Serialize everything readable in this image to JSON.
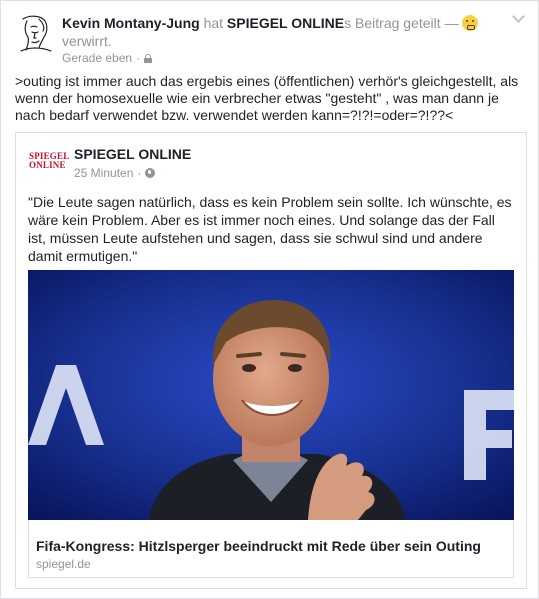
{
  "post": {
    "author": "Kevin Montany-Jung",
    "shared_word": "hat",
    "page_name": "SPIEGEL ONLINE",
    "shared_suffix": "s Beitrag geteilt —",
    "feeling": "verwirrt.",
    "time": "Gerade eben",
    "dot": "·",
    "text": ">outing ist immer auch das ergebis eines (öffentlichen) verhör's gleichgestellt, als wenn der homosexuelle wie ein  verbrecher etwas \"gesteht\" , was man dann je nach bedarf verwendet bzw. verwendet werden kann=?!?!=oder=?!??<"
  },
  "shared": {
    "logo_text": "SPIEGEL ONLINE",
    "page_name": "SPIEGEL ONLINE",
    "time": "25 Minuten",
    "dot": "·",
    "quote": "\"Die Leute sagen natürlich, dass es kein Problem sein sollte. Ich wünschte, es wäre kein Problem. Aber es ist immer noch eines. Und solange das der Fall ist, müssen Leute aufstehen und sagen, dass sie schwul sind und andere damit ermutigen.\"",
    "link_title": "Fifa-Kongress: Hitzlsperger beeindruckt mit Rede über sein Outing",
    "link_domain": "spiegel.de"
  },
  "colors": {
    "photo_background": "#142a8a",
    "spiegel_red": "#c8102e",
    "meta_gray": "#90949c"
  },
  "icons": [
    "avatar-sketch",
    "confused-emoji-icon",
    "lock-icon",
    "chevron-down-icon",
    "globe-icon"
  ]
}
